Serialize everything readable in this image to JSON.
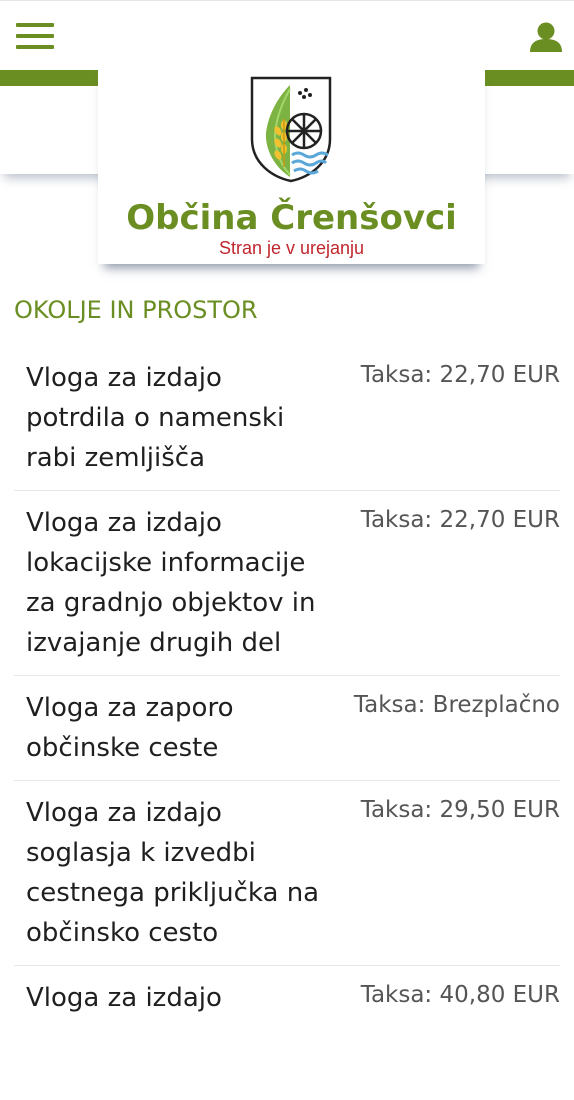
{
  "header": {
    "menu_icon": "hamburger-menu-icon",
    "user_icon": "user-icon",
    "accent_color": "#6b8e23"
  },
  "logo": {
    "crest_icon": "municipal-crest",
    "title": "Občina Črenšovci",
    "subtitle": "Stran je v urejanju",
    "subtitle_color": "#c0262d"
  },
  "section": {
    "title": "OKOLJE IN PROSTOR"
  },
  "services": [
    {
      "name": "Vloga za izdajo potrdila o namenski rabi zemljišča",
      "fee": "Taksa: 22,70 EUR"
    },
    {
      "name": "Vloga za izdajo lokacijske informacije za gradnjo objektov in izvajanje drugih del",
      "fee": "Taksa: 22,70 EUR"
    },
    {
      "name": "Vloga za zaporo občinske ceste",
      "fee": "Taksa: Brezplačno"
    },
    {
      "name": "Vloga za izdajo soglasja k izvedbi cestnega priključka na občinsko cesto",
      "fee": "Taksa: 29,50 EUR"
    },
    {
      "name": "Vloga za izdajo",
      "fee": "Taksa: 40,80 EUR"
    }
  ]
}
